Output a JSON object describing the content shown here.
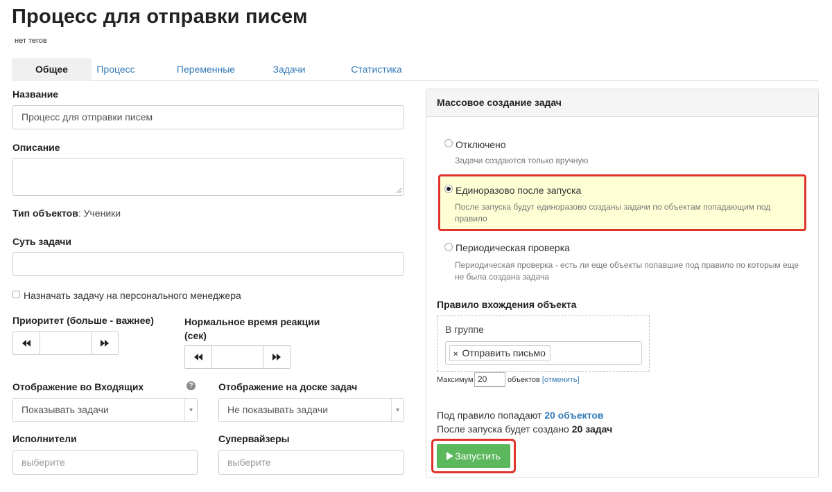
{
  "page": {
    "title": "Процесс для отправки писем",
    "tags": "нет тегов"
  },
  "tabs": [
    {
      "label": "Общее",
      "active": true
    },
    {
      "label": "Процесс"
    },
    {
      "label": "Переменные"
    },
    {
      "label": "Задачи"
    },
    {
      "label": "Статистика"
    }
  ],
  "form": {
    "name_label": "Название",
    "name_value": "Процесс для отправки писем",
    "description_label": "Описание",
    "description_value": "",
    "object_type_label": "Тип объектов",
    "object_type_value": ": Ученики",
    "task_label": "Суть задачи",
    "task_value": "",
    "assign_manager_label": "Назначать задачу на персонального менеджера",
    "priority_label": "Приоритет (больше - важнее)",
    "priority_value": "",
    "reaction_label_line1": "Нормальное время реакции",
    "reaction_label_line2": "(сек)",
    "reaction_value": "",
    "inbox_label": "Отображение во Входящих",
    "inbox_value": "Показывать задачи",
    "board_label": "Отображение на доске задач",
    "board_value": "Не показывать задачи",
    "executors_label": "Исполнители",
    "executors_placeholder": "выберите",
    "supervisors_label": "Супервайзеры",
    "supervisors_placeholder": "выберите"
  },
  "mass": {
    "title": "Массовое создание задач",
    "options": [
      {
        "title": "Отключено",
        "desc": "Задачи создаются только вручную",
        "checked": false
      },
      {
        "title": "Единоразово после запуска",
        "desc1": "После запуска будут единоразово созданы задачи по объектам попадающим под",
        "desc2": "правило",
        "checked": true
      },
      {
        "title": "Периодическая проверка",
        "desc1": "Периодическая проверка - есть ли еще объекты попавшие под правило по которым еще",
        "desc2": "не была создана задача",
        "checked": false
      }
    ],
    "rule_label": "Правило вхождения объекта",
    "group_label": "В группе",
    "token_remove": "×",
    "token_value": "Отправить письмо",
    "max_label": "Максимум",
    "max_value": "20",
    "objects_label": "объектов",
    "cancel_open": "[",
    "cancel_link": "отменить",
    "cancel_close": "]",
    "summary1_text": "Под правило попадают ",
    "summary1_link": "20 объектов",
    "summary2_text": "После запуска будет создано ",
    "summary2_bold": "20 задач",
    "run_label": "Запустить"
  },
  "colors": {
    "accent": "#337ab7",
    "run": "#5cb85c",
    "highlight_bg": "#ffffd6",
    "highlight_border": "#e0332c"
  }
}
